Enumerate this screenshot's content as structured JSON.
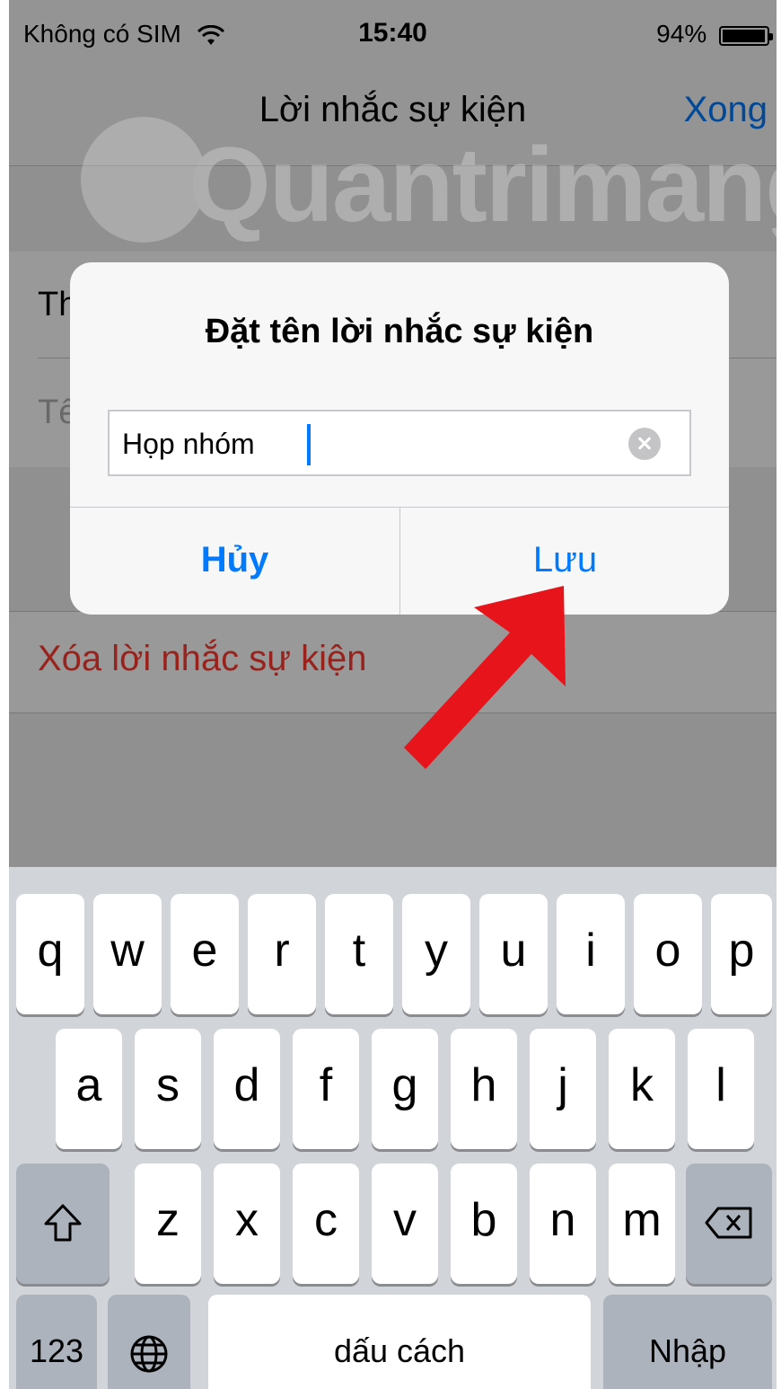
{
  "status_bar": {
    "carrier": "Không có SIM",
    "time": "15:40",
    "battery": "94%"
  },
  "nav": {
    "title": "Lời nhắc sự kiện",
    "done": "Xong"
  },
  "background_rows": {
    "row1_partial": "Th",
    "row2_partial": "Tê"
  },
  "delete_label": "Xóa lời nhắc sự kiện",
  "watermark": "Quantrimang",
  "alert": {
    "title": "Đặt tên lời nhắc sự kiện",
    "input_value": "Họp nhóm",
    "cancel": "Hủy",
    "save": "Lưu"
  },
  "keyboard": {
    "row1": [
      "q",
      "w",
      "e",
      "r",
      "t",
      "y",
      "u",
      "i",
      "o",
      "p"
    ],
    "row2": [
      "a",
      "s",
      "d",
      "f",
      "g",
      "h",
      "j",
      "k",
      "l"
    ],
    "row3": [
      "z",
      "x",
      "c",
      "v",
      "b",
      "n",
      "m"
    ],
    "numbers": "123",
    "space": "dấu cách",
    "return": "Nhập"
  },
  "icons": [
    "wifi-icon",
    "battery-icon",
    "clear-icon",
    "shift-icon",
    "backspace-icon",
    "globe-icon",
    "arrow-annotation"
  ],
  "colors": {
    "accent": "#007aff",
    "destructive": "#ff3b30",
    "annotation": "#e8141b"
  }
}
